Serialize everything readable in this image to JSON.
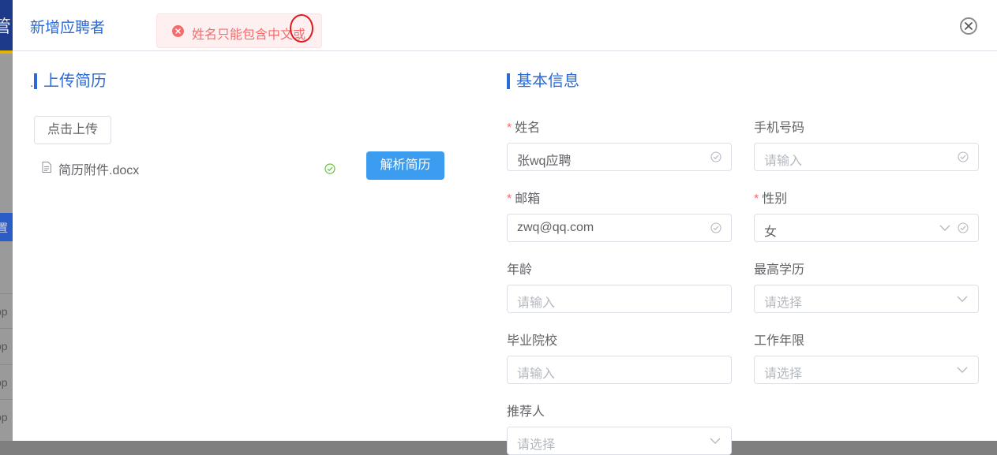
{
  "background": {
    "header_char": "管",
    "button_char": "置",
    "row_text": "op"
  },
  "dialog": {
    "title": "新增应聘者",
    "close_icon": "close-circle-icon"
  },
  "toast": {
    "type": "error",
    "icon": "error-circle-icon",
    "message": "姓名只能包含中文或"
  },
  "upload": {
    "section_title": "上传简历",
    "upload_button": "点击上传",
    "file_name": "简历附件.docx",
    "file_status_icon": "success-check-icon",
    "parse_button": "解析简历"
  },
  "basic_info": {
    "section_title": "基本信息",
    "fields": {
      "name": {
        "label": "姓名",
        "required": "*",
        "value": "张wq应聘"
      },
      "phone": {
        "label": "手机号码",
        "placeholder": "请输入"
      },
      "email": {
        "label": "邮箱",
        "required": "*",
        "value": "zwq@qq.com"
      },
      "gender": {
        "label": "性别",
        "required": "*",
        "value": "女"
      },
      "age": {
        "label": "年龄",
        "placeholder": "请输入"
      },
      "education": {
        "label": "最高学历",
        "placeholder": "请选择"
      },
      "school": {
        "label": "毕业院校",
        "placeholder": "请输入"
      },
      "work_years": {
        "label": "工作年限",
        "placeholder": "请选择"
      },
      "referrer": {
        "label": "推荐人",
        "placeholder": "请选择"
      }
    }
  },
  "colors": {
    "accent": "#2c6ad6",
    "primary_button": "#3c9cf0",
    "error": "#f56c6c",
    "success": "#67c23a",
    "annotation_circle": "#e0191b"
  }
}
